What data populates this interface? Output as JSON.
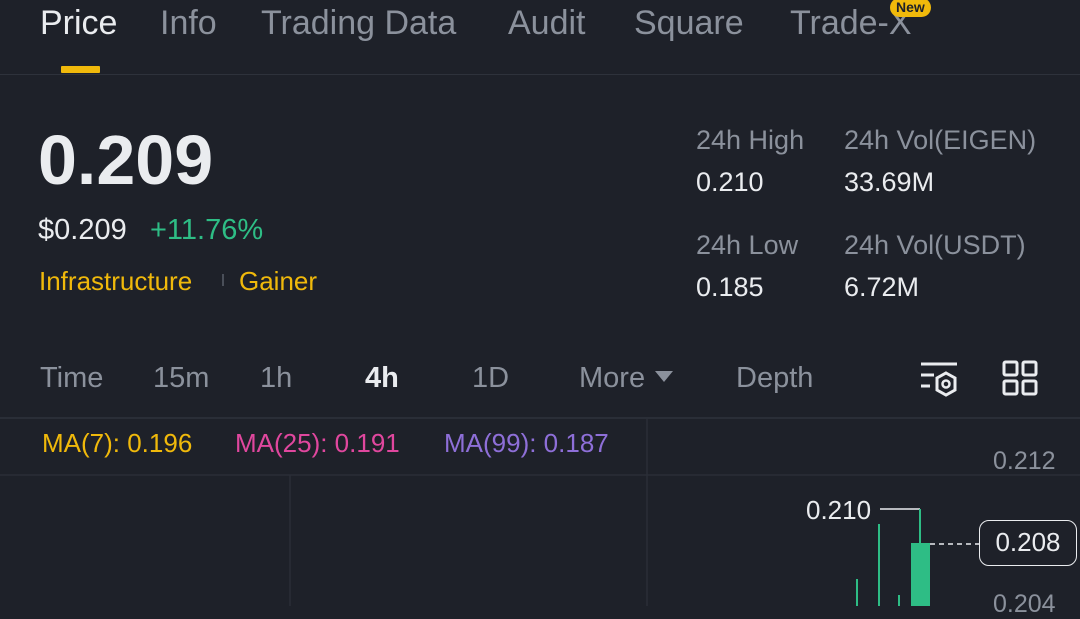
{
  "tabs": [
    {
      "label": "Price",
      "active": true
    },
    {
      "label": "Info"
    },
    {
      "label": "Trading Data"
    },
    {
      "label": "Audit"
    },
    {
      "label": "Square"
    },
    {
      "label": "Trade-X",
      "badge": "New"
    }
  ],
  "price": {
    "last": "0.209",
    "usd": "$0.209",
    "change": "+11.76%",
    "tags": [
      "Infrastructure",
      "Gainer"
    ]
  },
  "stats": {
    "high_label": "24h High",
    "high_value": "0.210",
    "vol_base_label": "24h Vol(EIGEN)",
    "vol_base_value": "33.69M",
    "low_label": "24h Low",
    "low_value": "0.185",
    "vol_quote_label": "24h Vol(USDT)",
    "vol_quote_value": "6.72M"
  },
  "intervals": [
    {
      "label": "Time"
    },
    {
      "label": "15m"
    },
    {
      "label": "1h"
    },
    {
      "label": "4h",
      "active": true
    },
    {
      "label": "1D"
    },
    {
      "label": "More"
    },
    {
      "label": "Depth"
    }
  ],
  "ma": {
    "ma7": "MA(7): 0.196",
    "ma25": "MA(25): 0.191",
    "ma99": "MA(99): 0.187"
  },
  "chart": {
    "y_top": "0.212",
    "y_next": "0.204",
    "high_marker": "0.210",
    "last_price": "0.208"
  },
  "colors": {
    "background": "#1e2129",
    "accent": "#f0b90b",
    "up": "#2ebd85",
    "ma7": "#f0b90b",
    "ma25": "#e0479e",
    "ma99": "#8e6fd8"
  }
}
